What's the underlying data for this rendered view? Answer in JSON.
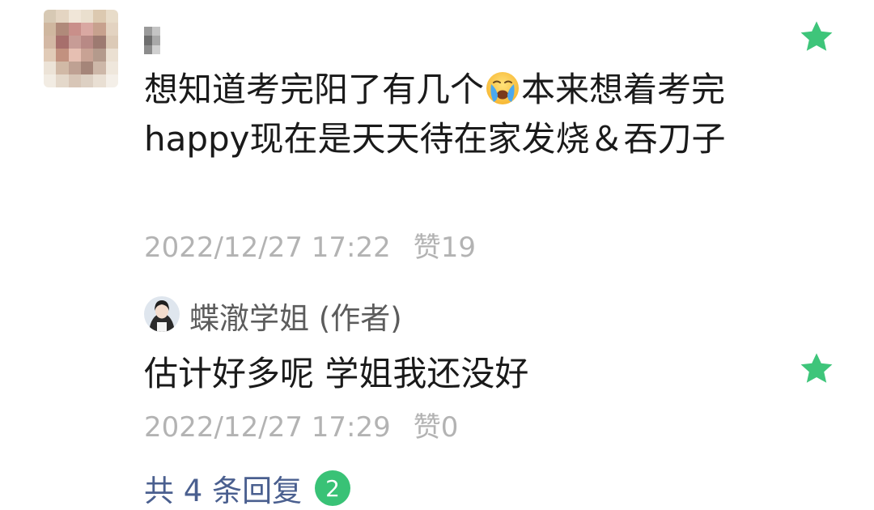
{
  "comment": {
    "avatar_icon": "blurred-avatar",
    "username_icon": "mosaic-username",
    "text_part1": "想知道考完阳了有几个",
    "emoji_icon": "loudly-crying-face-emoji",
    "text_part2": "本来想着考完happy现在是天天待在家发烧＆吞刀子",
    "date": "2022/12/27 17:22",
    "like_label": "赞",
    "like_count": "19",
    "star_icon": "green-star-icon"
  },
  "reply": {
    "avatar_icon": "author-avatar",
    "author": "蝶澈学姐 (作者)",
    "text": "估计好多呢 学姐我还没好",
    "date": "2022/12/27 17:29",
    "like_label": "赞",
    "like_count": "0",
    "star_icon": "green-star-icon"
  },
  "view_replies": {
    "label": "共 4 条回复",
    "badge": "2"
  },
  "colors": {
    "star": "#3ec57a",
    "badge": "#39c276",
    "link": "#4a5f8f",
    "meta": "#b3b3b3"
  }
}
